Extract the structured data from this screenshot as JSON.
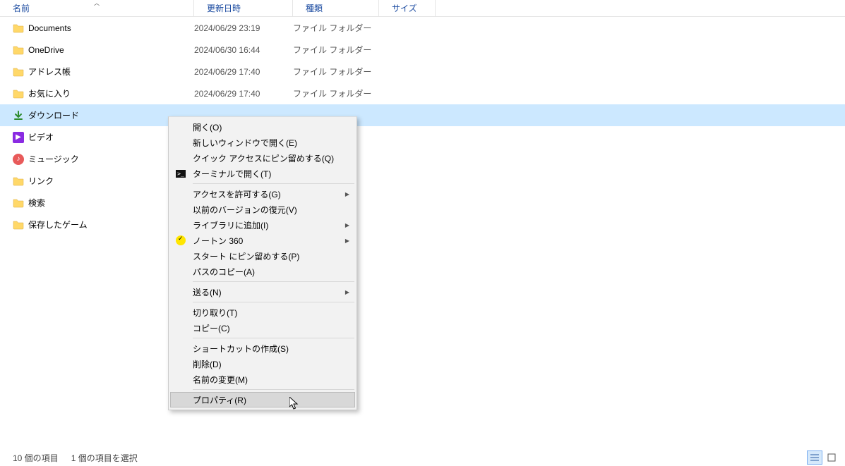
{
  "header": {
    "name": "名前",
    "date": "更新日時",
    "type": "種類",
    "size": "サイズ"
  },
  "rows": [
    {
      "icon": "folder",
      "name": "Documents",
      "date": "2024/06/29 23:19",
      "type": "ファイル フォルダー"
    },
    {
      "icon": "folder",
      "name": "OneDrive",
      "date": "2024/06/30 16:44",
      "type": "ファイル フォルダー"
    },
    {
      "icon": "folder",
      "name": "アドレス帳",
      "date": "2024/06/29 17:40",
      "type": "ファイル フォルダー"
    },
    {
      "icon": "folder",
      "name": "お気に入り",
      "date": "2024/06/29 17:40",
      "type": "ファイル フォルダー"
    },
    {
      "icon": "download",
      "name": "ダウンロード",
      "date": "",
      "type": "",
      "selected": true
    },
    {
      "icon": "video",
      "name": "ビデオ",
      "date": "",
      "type": ""
    },
    {
      "icon": "music",
      "name": "ミュージック",
      "date": "",
      "type": ""
    },
    {
      "icon": "folder",
      "name": "リンク",
      "date": "",
      "type": ""
    },
    {
      "icon": "folder",
      "name": "検索",
      "date": "",
      "type": ""
    },
    {
      "icon": "folder",
      "name": "保存したゲーム",
      "date": "",
      "type": ""
    }
  ],
  "context_menu": [
    {
      "label": "開く(O)"
    },
    {
      "label": "新しいウィンドウで開く(E)"
    },
    {
      "label": "クイック アクセスにピン留めする(Q)"
    },
    {
      "label": "ターミナルで開く(T)",
      "icon": "terminal"
    },
    {
      "sep": true
    },
    {
      "label": "アクセスを許可する(G)",
      "submenu": true
    },
    {
      "label": "以前のバージョンの復元(V)"
    },
    {
      "label": "ライブラリに追加(I)",
      "submenu": true
    },
    {
      "label": "ノートン 360",
      "icon": "norton",
      "submenu": true
    },
    {
      "label": "スタート にピン留めする(P)"
    },
    {
      "label": "パスのコピー(A)"
    },
    {
      "sep": true
    },
    {
      "label": "送る(N)",
      "submenu": true
    },
    {
      "sep": true
    },
    {
      "label": "切り取り(T)"
    },
    {
      "label": "コピー(C)"
    },
    {
      "sep": true
    },
    {
      "label": "ショートカットの作成(S)"
    },
    {
      "label": "削除(D)"
    },
    {
      "label": "名前の変更(M)"
    },
    {
      "sep": true
    },
    {
      "label": "プロパティ(R)",
      "hovered": true
    }
  ],
  "status": {
    "count": "10 個の項目",
    "selected": "1 個の項目を選択"
  }
}
